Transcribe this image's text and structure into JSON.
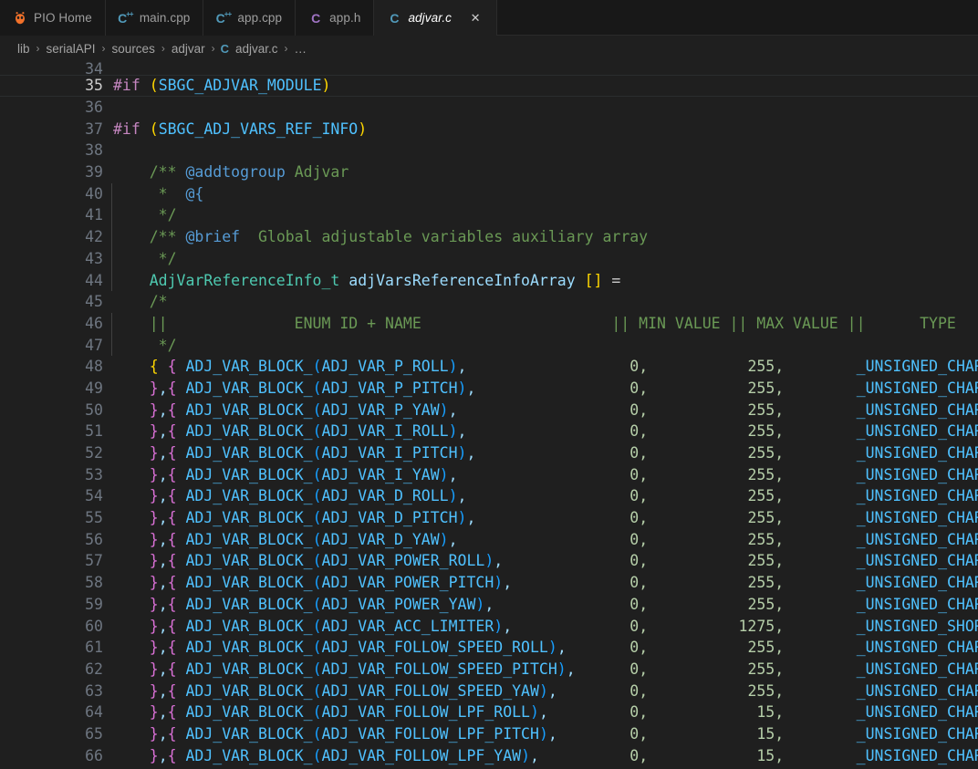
{
  "window": {
    "editor_bg": "#1f1f1f",
    "tabbar_bg": "#181818",
    "accent": "#519aba"
  },
  "tabs": [
    {
      "label": "PIO Home",
      "icon": "platformio-alien-icon",
      "kind": "pio",
      "active": false,
      "closable": false
    },
    {
      "label": "main.cpp",
      "icon": "cpp-file-icon",
      "kind": "cpp",
      "active": false,
      "closable": false
    },
    {
      "label": "app.cpp",
      "icon": "cpp-file-icon",
      "kind": "cpp",
      "active": false,
      "closable": false
    },
    {
      "label": "app.h",
      "icon": "c-header-file-icon",
      "kind": "h",
      "active": false,
      "closable": false
    },
    {
      "label": "adjvar.c",
      "icon": "c-file-icon",
      "kind": "c",
      "active": true,
      "closable": true,
      "close_label": "✕"
    }
  ],
  "breadcrumb": {
    "separator": "›",
    "file_icon": "c-file-icon",
    "items": [
      {
        "label": "lib",
        "icon": null
      },
      {
        "label": "serialAPI",
        "icon": null
      },
      {
        "label": "sources",
        "icon": null
      },
      {
        "label": "adjvar",
        "icon": null
      },
      {
        "label": "adjvar.c",
        "icon": "C"
      },
      {
        "label": "…",
        "icon": null
      }
    ]
  },
  "editor": {
    "language": "c",
    "first_visible_line": 34,
    "current_line": 35,
    "lines": [
      {
        "n": 34,
        "partial": true,
        "tokens": []
      },
      {
        "n": 35,
        "tokens": [
          {
            "t": "#if ",
            "c": "t-pre"
          },
          {
            "t": "(",
            "c": "t-paren1"
          },
          {
            "t": "SBGC_ADJVAR_MODULE",
            "c": "t-macro"
          },
          {
            "t": ")",
            "c": "t-paren1"
          }
        ]
      },
      {
        "n": 36,
        "tokens": []
      },
      {
        "n": 37,
        "tokens": [
          {
            "t": "#if ",
            "c": "t-pre"
          },
          {
            "t": "(",
            "c": "t-paren1"
          },
          {
            "t": "SBGC_ADJ_VARS_REF_INFO",
            "c": "t-macro"
          },
          {
            "t": ")",
            "c": "t-paren1"
          }
        ]
      },
      {
        "n": 38,
        "tokens": []
      },
      {
        "n": 39,
        "tokens": [
          {
            "t": "    /** ",
            "c": "t-comment"
          },
          {
            "t": "@addtogroup",
            "c": "t-doctag"
          },
          {
            "t": " Adjvar",
            "c": "t-comment"
          }
        ]
      },
      {
        "n": 40,
        "tokens": [
          {
            "t": "     *  ",
            "c": "t-comment"
          },
          {
            "t": "@{",
            "c": "t-doctag"
          }
        ]
      },
      {
        "n": 41,
        "tokens": [
          {
            "t": "     */",
            "c": "t-comment"
          }
        ]
      },
      {
        "n": 42,
        "tokens": [
          {
            "t": "    /** ",
            "c": "t-comment"
          },
          {
            "t": "@brief",
            "c": "t-doctag"
          },
          {
            "t": "  Global adjustable variables auxiliary array",
            "c": "t-comment"
          }
        ]
      },
      {
        "n": 43,
        "tokens": [
          {
            "t": "     */",
            "c": "t-comment"
          }
        ]
      },
      {
        "n": 44,
        "tokens": [
          {
            "t": "    AdjVarReferenceInfo_t",
            "c": "t-type"
          },
          {
            "t": " adjVarsReferenceInfoArray",
            "c": "t-var"
          },
          {
            "t": " []",
            "c": "t-paren1"
          },
          {
            "t": " =",
            "c": "t-punc"
          }
        ]
      },
      {
        "n": 45,
        "tokens": [
          {
            "t": "    /*",
            "c": "t-comment"
          }
        ]
      },
      {
        "n": 46,
        "tokens": [
          {
            "t": "    ||              ENUM ID + NAME                     || MIN VALUE || MAX VALUE ||      TYPE      ||",
            "c": "t-comment"
          }
        ]
      },
      {
        "n": 47,
        "tokens": [
          {
            "t": "     */",
            "c": "t-comment"
          }
        ]
      },
      {
        "n": 48,
        "row": {
          "open": "{ {",
          "open_style": "first",
          "name": "ADJ_VAR_P_ROLL",
          "min": "0,",
          "max": "255,",
          "type": "_UNSIGNED_CHAR_"
        }
      },
      {
        "n": 49,
        "row": {
          "open": "},{",
          "name": "ADJ_VAR_P_PITCH",
          "min": "0,",
          "max": "255,",
          "type": "_UNSIGNED_CHAR_"
        }
      },
      {
        "n": 50,
        "row": {
          "open": "},{",
          "name": "ADJ_VAR_P_YAW",
          "min": "0,",
          "max": "255,",
          "type": "_UNSIGNED_CHAR_"
        }
      },
      {
        "n": 51,
        "row": {
          "open": "},{",
          "name": "ADJ_VAR_I_ROLL",
          "min": "0,",
          "max": "255,",
          "type": "_UNSIGNED_CHAR_"
        }
      },
      {
        "n": 52,
        "row": {
          "open": "},{",
          "name": "ADJ_VAR_I_PITCH",
          "min": "0,",
          "max": "255,",
          "type": "_UNSIGNED_CHAR_"
        }
      },
      {
        "n": 53,
        "row": {
          "open": "},{",
          "name": "ADJ_VAR_I_YAW",
          "min": "0,",
          "max": "255,",
          "type": "_UNSIGNED_CHAR_"
        }
      },
      {
        "n": 54,
        "row": {
          "open": "},{",
          "name": "ADJ_VAR_D_ROLL",
          "min": "0,",
          "max": "255,",
          "type": "_UNSIGNED_CHAR_"
        }
      },
      {
        "n": 55,
        "row": {
          "open": "},{",
          "name": "ADJ_VAR_D_PITCH",
          "min": "0,",
          "max": "255,",
          "type": "_UNSIGNED_CHAR_"
        }
      },
      {
        "n": 56,
        "row": {
          "open": "},{",
          "name": "ADJ_VAR_D_YAW",
          "min": "0,",
          "max": "255,",
          "type": "_UNSIGNED_CHAR_"
        }
      },
      {
        "n": 57,
        "row": {
          "open": "},{",
          "name": "ADJ_VAR_POWER_ROLL",
          "min": "0,",
          "max": "255,",
          "type": "_UNSIGNED_CHAR_"
        }
      },
      {
        "n": 58,
        "row": {
          "open": "},{",
          "name": "ADJ_VAR_POWER_PITCH",
          "min": "0,",
          "max": "255,",
          "type": "_UNSIGNED_CHAR_"
        }
      },
      {
        "n": 59,
        "row": {
          "open": "},{",
          "name": "ADJ_VAR_POWER_YAW",
          "min": "0,",
          "max": "255,",
          "type": "_UNSIGNED_CHAR_"
        }
      },
      {
        "n": 60,
        "row": {
          "open": "},{",
          "name": "ADJ_VAR_ACC_LIMITER",
          "min": "0,",
          "max": "1275,",
          "type": "_UNSIGNED_SHORT_"
        }
      },
      {
        "n": 61,
        "row": {
          "open": "},{",
          "name": "ADJ_VAR_FOLLOW_SPEED_ROLL",
          "min": "0,",
          "max": "255,",
          "type": "_UNSIGNED_CHAR_"
        }
      },
      {
        "n": 62,
        "row": {
          "open": "},{",
          "name": "ADJ_VAR_FOLLOW_SPEED_PITCH",
          "min": "0,",
          "max": "255,",
          "type": "_UNSIGNED_CHAR_"
        }
      },
      {
        "n": 63,
        "row": {
          "open": "},{",
          "name": "ADJ_VAR_FOLLOW_SPEED_YAW",
          "min": "0,",
          "max": "255,",
          "type": "_UNSIGNED_CHAR_"
        }
      },
      {
        "n": 64,
        "row": {
          "open": "},{",
          "name": "ADJ_VAR_FOLLOW_LPF_ROLL",
          "min": "0,",
          "max": "15,",
          "type": "_UNSIGNED_CHAR_"
        }
      },
      {
        "n": 65,
        "row": {
          "open": "},{",
          "name": "ADJ_VAR_FOLLOW_LPF_PITCH",
          "min": "0,",
          "max": "15,",
          "type": "_UNSIGNED_CHAR_"
        }
      },
      {
        "n": 66,
        "row": {
          "open": "},{",
          "name": "ADJ_VAR_FOLLOW_LPF_YAW",
          "min": "0,",
          "max": "15,",
          "type": "_UNSIGNED_CHAR_"
        }
      }
    ],
    "macro_call": "ADJ_VAR_BLOCK_"
  }
}
